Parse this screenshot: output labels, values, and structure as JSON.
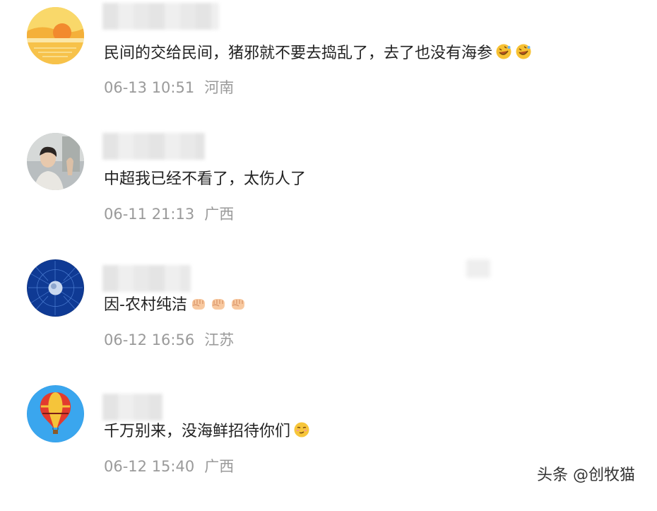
{
  "comments": [
    {
      "text": "民间的交给民间，猪邪就不要去捣乱了，去了也没有海参",
      "emojis": [
        "rofl-emoji",
        "rofl-emoji"
      ],
      "time": "06-13 10:51",
      "location": "河南",
      "avatar": "sunset-avatar"
    },
    {
      "text": "中超我已经不看了，太伤人了",
      "emojis": [],
      "time": "06-11 21:13",
      "location": "广西",
      "avatar": "person-photo-avatar"
    },
    {
      "text": "因-农村纯洁",
      "emojis": [
        "fist-emoji",
        "fist-emoji",
        "fist-emoji"
      ],
      "time": "06-12 16:56",
      "location": "江苏",
      "avatar": "earth-network-avatar"
    },
    {
      "text": "千万别来，没海鲜招待你们",
      "emojis": [
        "smirk-emoji"
      ],
      "time": "06-12 15:40",
      "location": "广西",
      "avatar": "hot-air-balloon-avatar"
    }
  ],
  "watermark": "头条 @创牧猫",
  "colors": {
    "text": "#222222",
    "meta": "#9a9a9a",
    "background": "#ffffff"
  }
}
